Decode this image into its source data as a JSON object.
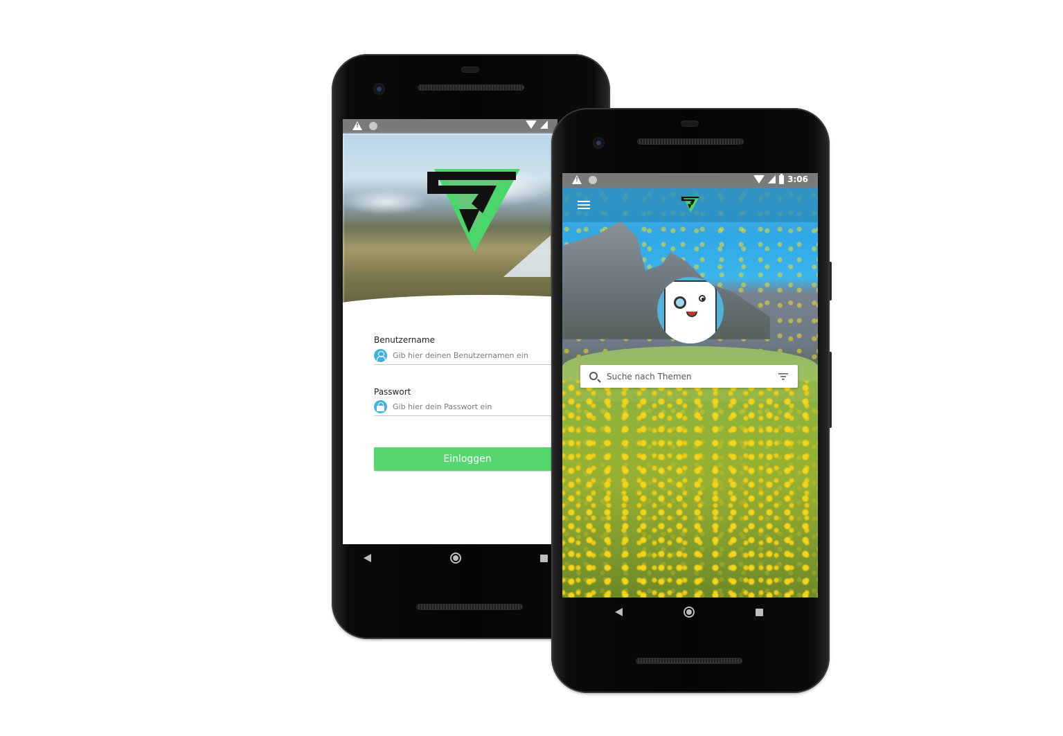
{
  "back_phone": {
    "login": {
      "username_label": "Benutzername",
      "username_placeholder": "Gib hier deinen Benutzernamen ein",
      "password_label": "Passwort",
      "password_placeholder": "Gib hier dein Passwort ein",
      "login_button": "Einloggen"
    },
    "status_icons": [
      "warning-icon",
      "circle-icon",
      "wifi-icon",
      "signal-icon"
    ]
  },
  "front_phone": {
    "status": {
      "time": "3:06",
      "icons": [
        "warning-icon",
        "circle-icon",
        "wifi-icon",
        "signal-icon",
        "battery-icon"
      ]
    },
    "appbar": {
      "menu_icon": "hamburger-menu-icon",
      "logo": "app-logo"
    },
    "search": {
      "placeholder": "Suche nach Themen",
      "filter_icon": "filter-icon"
    }
  },
  "colors": {
    "accent_green": "#55d66f",
    "logo_green": "#4bd66a",
    "icon_blue": "#44b3e0",
    "appbar_blue": "#268cbe",
    "status_gray": "#7a7a7a"
  }
}
